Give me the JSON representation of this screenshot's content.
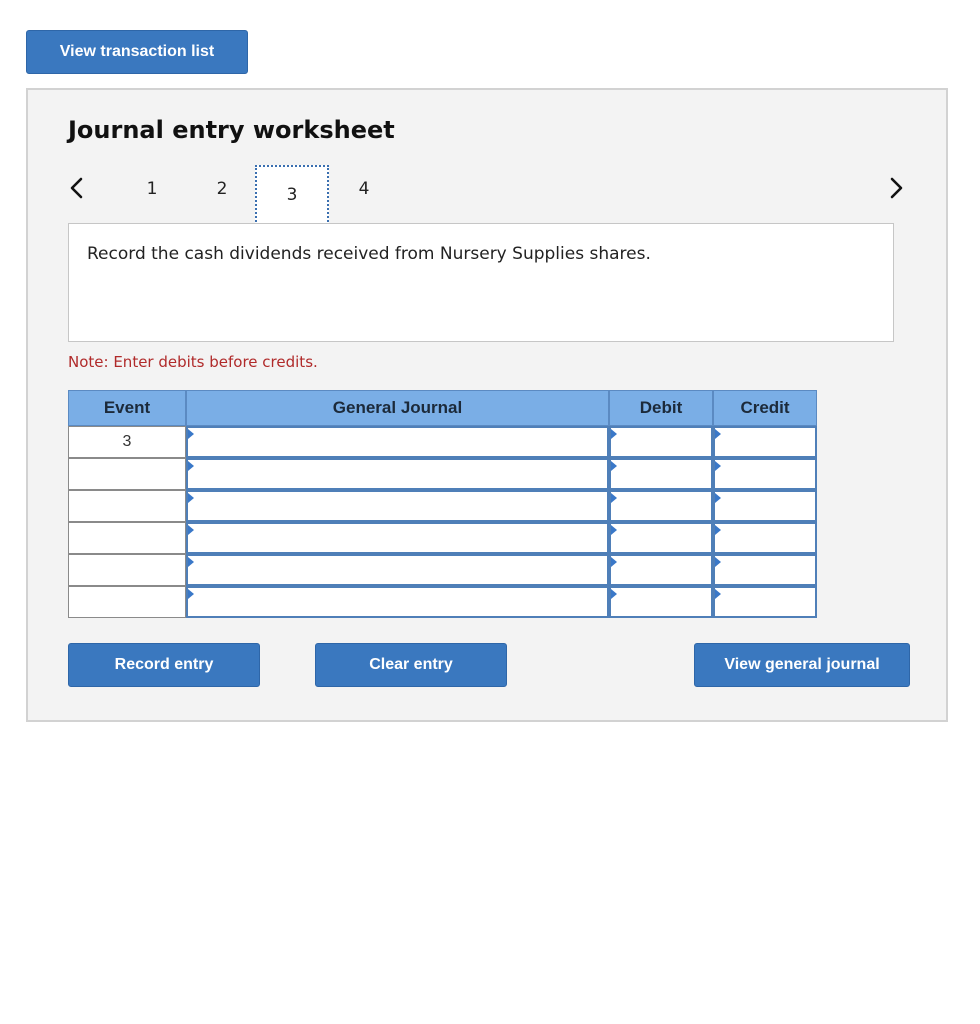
{
  "top": {
    "view_transaction_list": "View transaction list"
  },
  "worksheet": {
    "title": "Journal entry worksheet",
    "pages": [
      "1",
      "2",
      "3",
      "4"
    ],
    "current_page": "3",
    "prompt": "Record the cash dividends received from Nursery Supplies shares.",
    "note": "Note: Enter debits before credits."
  },
  "journal": {
    "headers": {
      "event": "Event",
      "general_journal": "General Journal",
      "debit": "Debit",
      "credit": "Credit"
    },
    "rows": [
      {
        "event": "3",
        "account": "",
        "debit": "",
        "credit": ""
      },
      {
        "event": "",
        "account": "",
        "debit": "",
        "credit": ""
      },
      {
        "event": "",
        "account": "",
        "debit": "",
        "credit": ""
      },
      {
        "event": "",
        "account": "",
        "debit": "",
        "credit": ""
      },
      {
        "event": "",
        "account": "",
        "debit": "",
        "credit": ""
      },
      {
        "event": "",
        "account": "",
        "debit": "",
        "credit": ""
      }
    ]
  },
  "buttons": {
    "record_entry": "Record entry",
    "clear_entry": "Clear entry",
    "view_general_journal": "View general journal"
  },
  "icons": {
    "prev": "chevron-left-icon",
    "next": "chevron-right-icon",
    "dropdown": "triangle-marker-icon"
  },
  "colors": {
    "button": "#3a78bf",
    "header": "#7aaee6",
    "note": "#b02a2a",
    "panel": "#f3f3f3"
  }
}
